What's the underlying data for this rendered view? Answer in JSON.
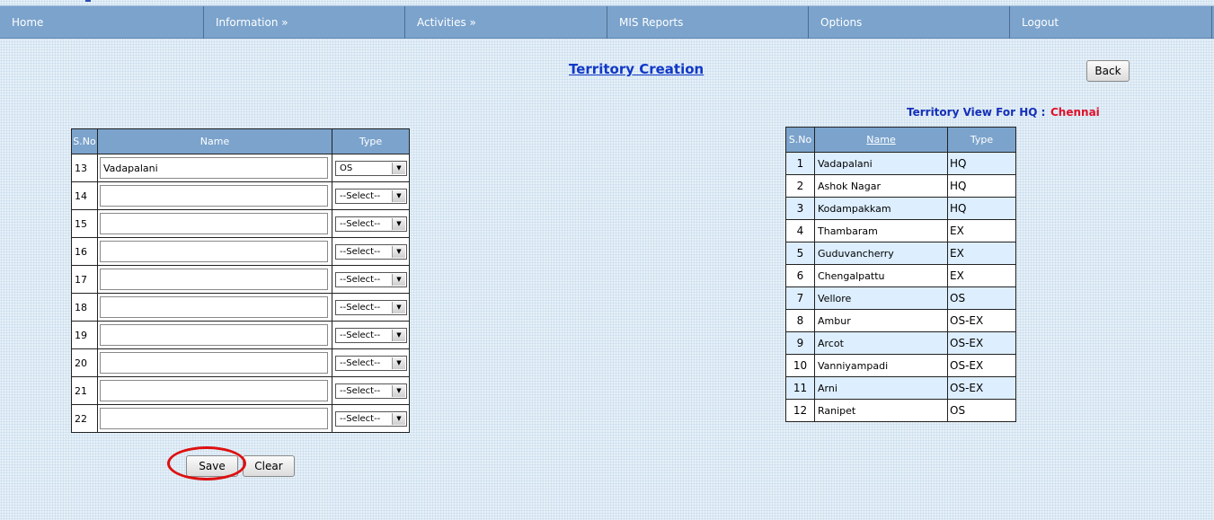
{
  "nav": {
    "items": [
      {
        "label": "Home"
      },
      {
        "label": "Information »"
      },
      {
        "label": "Activities »"
      },
      {
        "label": "MIS Reports"
      },
      {
        "label": "Options"
      },
      {
        "label": "Logout"
      }
    ]
  },
  "page": {
    "title": "Territory Creation",
    "back_label": "Back"
  },
  "hq": {
    "label": "Territory View For HQ :",
    "value": "Chennai"
  },
  "form_table": {
    "headers": {
      "sno": "S.No",
      "name": "Name",
      "type": "Type"
    },
    "rows": [
      {
        "sno": "13",
        "name": "Vadapalani",
        "type": "OS"
      },
      {
        "sno": "14",
        "name": "",
        "type": "--Select--"
      },
      {
        "sno": "15",
        "name": "",
        "type": "--Select--"
      },
      {
        "sno": "16",
        "name": "",
        "type": "--Select--"
      },
      {
        "sno": "17",
        "name": "",
        "type": "--Select--"
      },
      {
        "sno": "18",
        "name": "",
        "type": "--Select--"
      },
      {
        "sno": "19",
        "name": "",
        "type": "--Select--"
      },
      {
        "sno": "20",
        "name": "",
        "type": "--Select--"
      },
      {
        "sno": "21",
        "name": "",
        "type": "--Select--"
      },
      {
        "sno": "22",
        "name": "",
        "type": "--Select--"
      }
    ]
  },
  "actions": {
    "save_label": "Save",
    "clear_label": "Clear"
  },
  "view_table": {
    "headers": {
      "sno": "S.No",
      "name": "Name",
      "type": "Type"
    },
    "rows": [
      {
        "sno": "1",
        "name": "Vadapalani",
        "type": "HQ"
      },
      {
        "sno": "2",
        "name": "Ashok Nagar",
        "type": "HQ"
      },
      {
        "sno": "3",
        "name": "Kodampakkam",
        "type": "HQ"
      },
      {
        "sno": "4",
        "name": "Thambaram",
        "type": "EX"
      },
      {
        "sno": "5",
        "name": "Guduvancherry",
        "type": "EX"
      },
      {
        "sno": "6",
        "name": "Chengalpattu",
        "type": "EX"
      },
      {
        "sno": "7",
        "name": "Vellore",
        "type": "OS"
      },
      {
        "sno": "8",
        "name": "Ambur",
        "type": "OS-EX"
      },
      {
        "sno": "9",
        "name": "Arcot",
        "type": "OS-EX"
      },
      {
        "sno": "10",
        "name": "Vanniyampadi",
        "type": "OS-EX"
      },
      {
        "sno": "11",
        "name": "Arni",
        "type": "OS-EX"
      },
      {
        "sno": "12",
        "name": "Ranipet",
        "type": "OS"
      }
    ]
  },
  "colors": {
    "nav_bg": "#7ba3cc",
    "title": "#1038c8",
    "hq_label": "#1530b8",
    "hq_value": "#e0102a",
    "row_alt": "#ddeeff",
    "highlight": "#dd1010"
  }
}
